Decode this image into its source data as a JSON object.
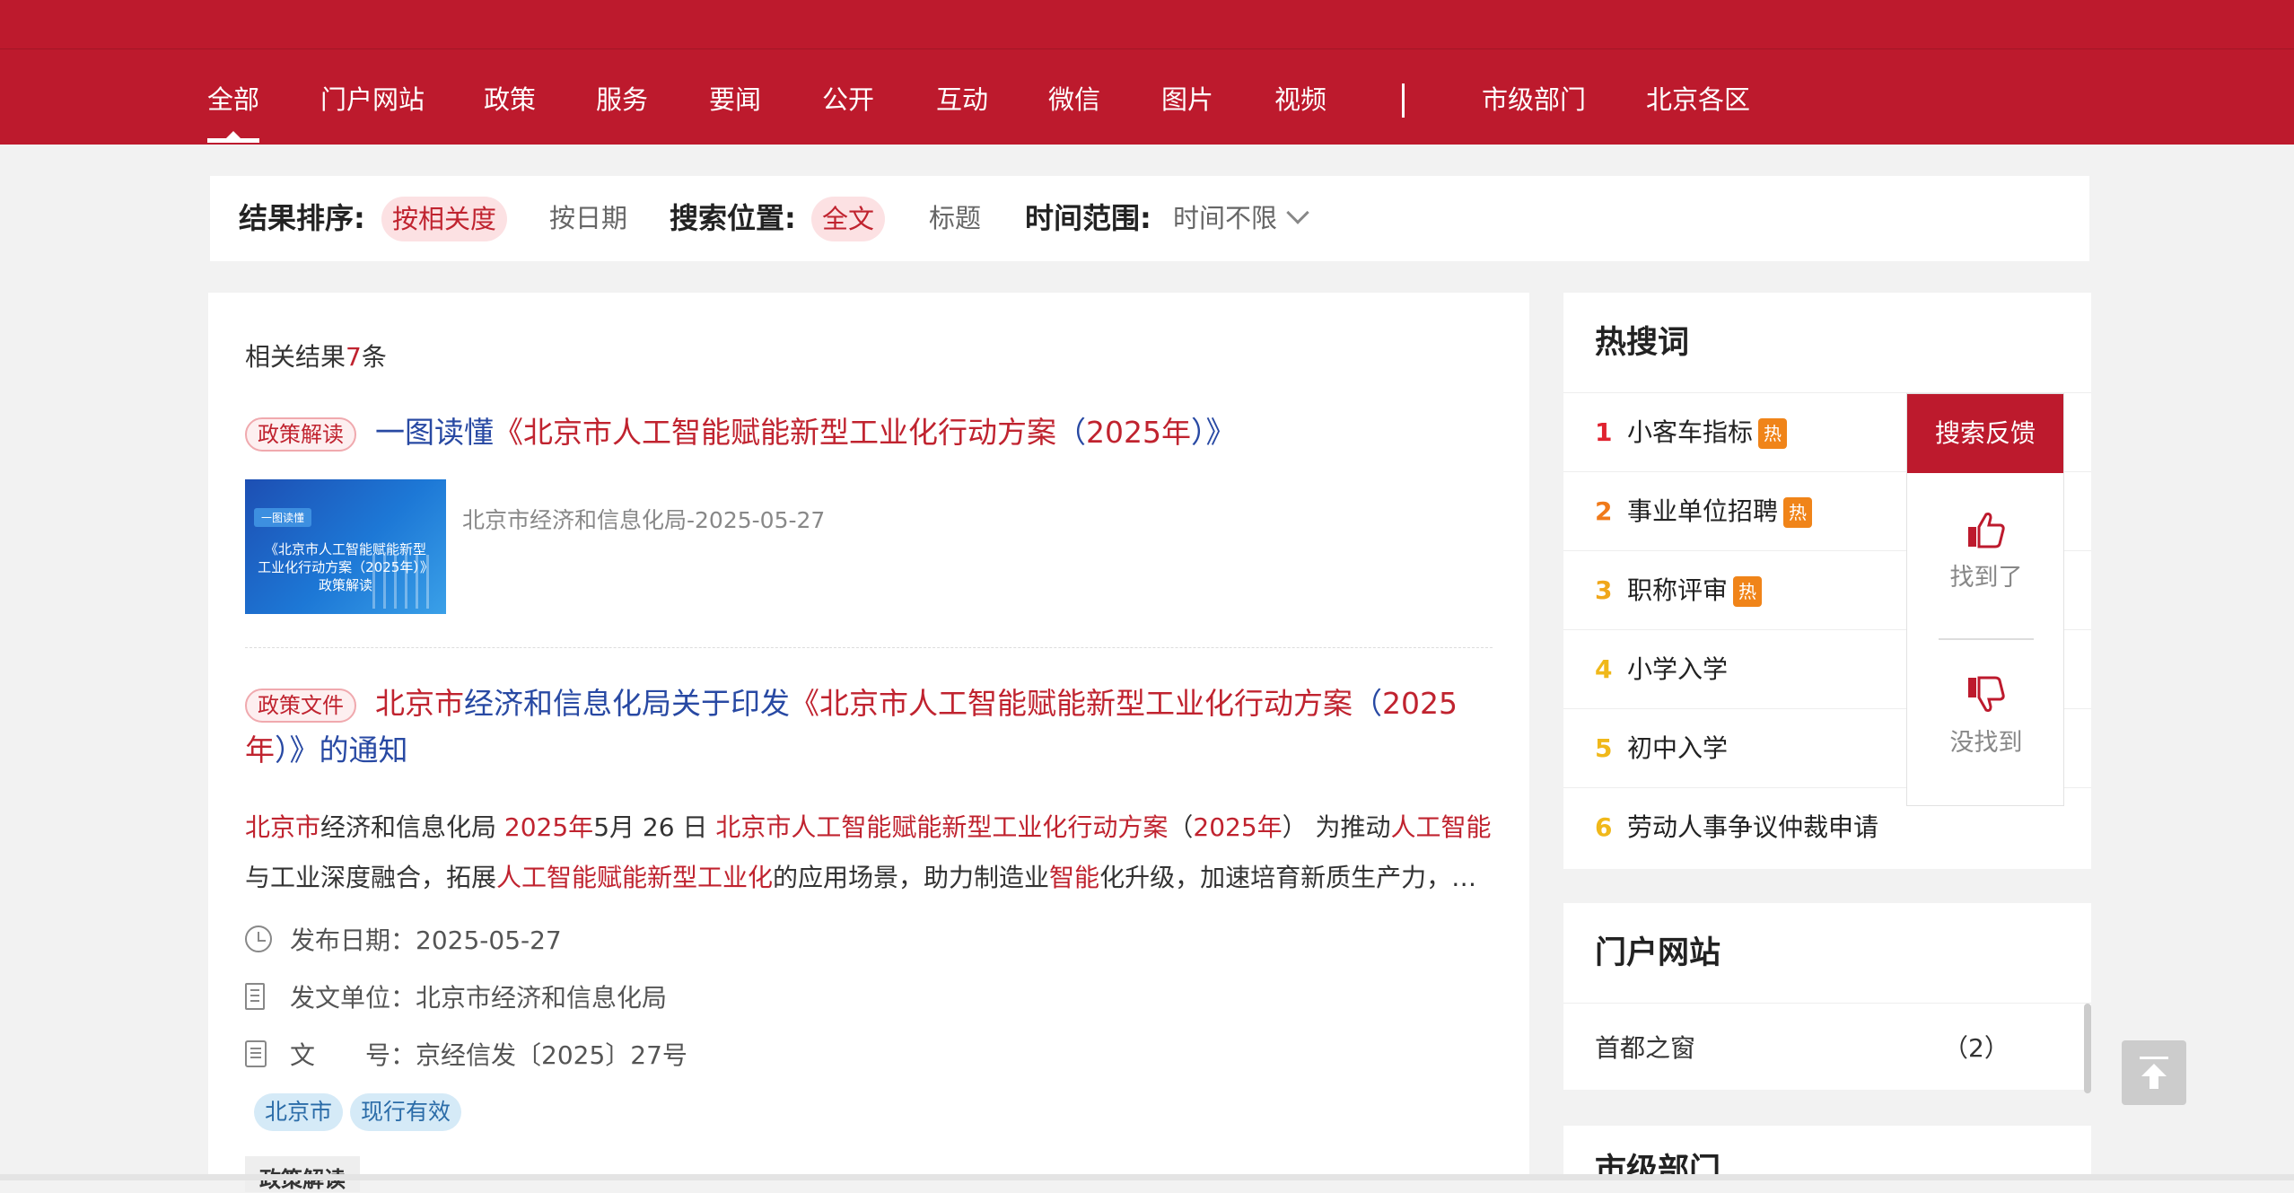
{
  "nav": {
    "items": [
      "全部",
      "门户网站",
      "政策",
      "服务",
      "要闻",
      "公开",
      "互动",
      "微信",
      "图片",
      "视频"
    ],
    "separator": "|",
    "extra": [
      "市级部门",
      "北京各区"
    ]
  },
  "filters": {
    "sort_label": "结果排序:",
    "sort_options": [
      "按相关度",
      "按日期"
    ],
    "position_label": "搜索位置:",
    "position_options": [
      "全文",
      "标题"
    ],
    "time_label": "时间范围:",
    "time_value": "时间不限"
  },
  "results": {
    "count_prefix": "相关结果",
    "count": "7",
    "count_suffix": "条",
    "items": [
      {
        "tag": "政策解读",
        "title_a": "一图读懂",
        "title_b": "《北京市人工智能赋能新型工业化行动方案",
        "title_c": "（",
        "title_d": "2025年",
        "title_e": "）",
        "title_f": "》",
        "thumb_small": "一图读懂",
        "thumb_caption_1": "《北京市人工智能赋能新型",
        "thumb_caption_2": "工业化行动方案（2025年）》",
        "thumb_caption_3": "政策解读",
        "source": "北京市经济和信息化局-2025-05-27"
      },
      {
        "tag": "政策文件",
        "title_1": "北京市",
        "title_2": "经济和信息化局关于印发",
        "title_3": "《北京市人工智能赋能新型工业化行动方案",
        "title_4": "（",
        "title_5": "2025",
        "title_6": "年",
        "title_7": "）》的通知",
        "excerpt": {
          "s1": "北京市",
          "s2": "经济和信息化局 ",
          "s3": "2025年",
          "s4": "5月 26 日 ",
          "s5": "北京市人工智能赋能新型工业化行动方案",
          "s6": "（",
          "s7": "2025年",
          "s8": "） 为推动",
          "s9": "人工智能",
          "s10": "与工业深度融合，拓展",
          "s11": "人工智能赋能新型工业化",
          "s12": "的应用场景，助力制造业",
          "s13": "智能",
          "s14": "化升级，加速培育新质生产力，…"
        },
        "date_label": "发布日期：",
        "date": "2025-05-27",
        "issuer_label": "发文单位：",
        "issuer": "北京市经济和信息化局",
        "docno_label": "文　　号：",
        "docno": "京经信发〔2025〕27号",
        "chips": [
          "北京市",
          "现行有效"
        ]
      }
    ],
    "next_tag": "政策解读"
  },
  "hot": {
    "title": "热搜词",
    "badge": "热",
    "items": [
      {
        "rank": "1",
        "text": "小客车指标",
        "hot": true,
        "color": "#e0222f"
      },
      {
        "rank": "2",
        "text": "事业单位招聘",
        "hot": true,
        "color": "#f07a1a"
      },
      {
        "rank": "3",
        "text": "职称评审",
        "hot": true,
        "color": "#f0a71a"
      },
      {
        "rank": "4",
        "text": "小学入学",
        "hot": false,
        "color": "#f0b81a"
      },
      {
        "rank": "5",
        "text": "初中入学",
        "hot": false,
        "color": "#f0b81a"
      },
      {
        "rank": "6",
        "text": "劳动人事争议仲裁申请",
        "hot": false,
        "color": "#f0b81a"
      }
    ]
  },
  "portal": {
    "title": "门户网站",
    "row_name": "首都之窗",
    "row_count": "（2）"
  },
  "city": {
    "title": "市级部门"
  },
  "feedback": {
    "title": "搜索反馈",
    "found": "找到了",
    "not_found": "没找到"
  },
  "colors": {
    "brand_red": "#bd1a2d",
    "link_blue": "#2849a3",
    "highlight_red": "#c0232f"
  }
}
